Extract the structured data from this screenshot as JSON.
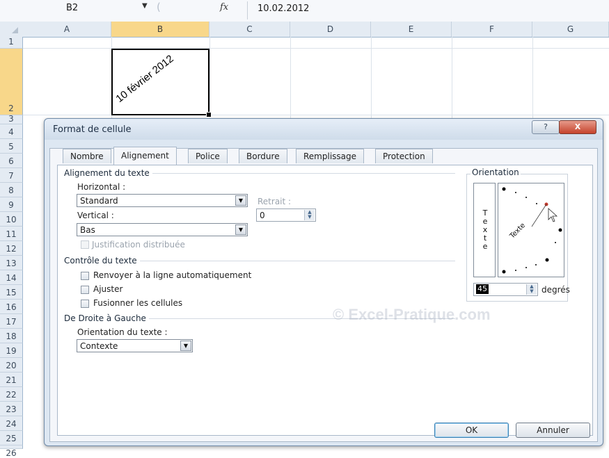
{
  "formula_bar": {
    "name_box": "B2",
    "fx_label": "fx",
    "formula": "10.02.2012"
  },
  "columns": [
    "A",
    "B",
    "C",
    "D",
    "E",
    "F",
    "G"
  ],
  "rows": [
    "1",
    "2",
    "3",
    "4",
    "5",
    "6",
    "7",
    "8",
    "9",
    "10",
    "11",
    "12",
    "13",
    "14",
    "15",
    "16",
    "17",
    "18",
    "19",
    "20",
    "21",
    "22",
    "23",
    "24",
    "25",
    "26"
  ],
  "selected_cell": {
    "ref": "B2",
    "display": "10 février 2012",
    "rotation_degrees": 45
  },
  "dialog": {
    "title": "Format de cellule",
    "help": "?",
    "close": "X",
    "tabs": [
      "Nombre",
      "Alignement",
      "Police",
      "Bordure",
      "Remplissage",
      "Protection"
    ],
    "active_tab": "Alignement",
    "text_alignment": {
      "group_label": "Alignement du texte",
      "horizontal_label": "Horizontal :",
      "horizontal_value": "Standard",
      "indent_label": "Retrait :",
      "indent_value": "0",
      "vertical_label": "Vertical :",
      "vertical_value": "Bas",
      "distributed_justify_label": "Justification distribuée"
    },
    "text_control": {
      "group_label": "Contrôle du texte",
      "wrap_text": "Renvoyer à la ligne automatiquement",
      "shrink_to_fit": "Ajuster",
      "merge_cells": "Fusionner les cellules"
    },
    "right_to_left": {
      "group_label": "De Droite à Gauche",
      "direction_label": "Orientation du texte :",
      "direction_value": "Contexte"
    },
    "orientation": {
      "group_label": "Orientation",
      "vertical_text": "Texte",
      "dial_text": "Texte",
      "degrees_value": "45",
      "degrees_label": "degrés"
    },
    "ok": "OK",
    "cancel": "Annuler"
  },
  "watermark": "© Excel-Pratique.com"
}
